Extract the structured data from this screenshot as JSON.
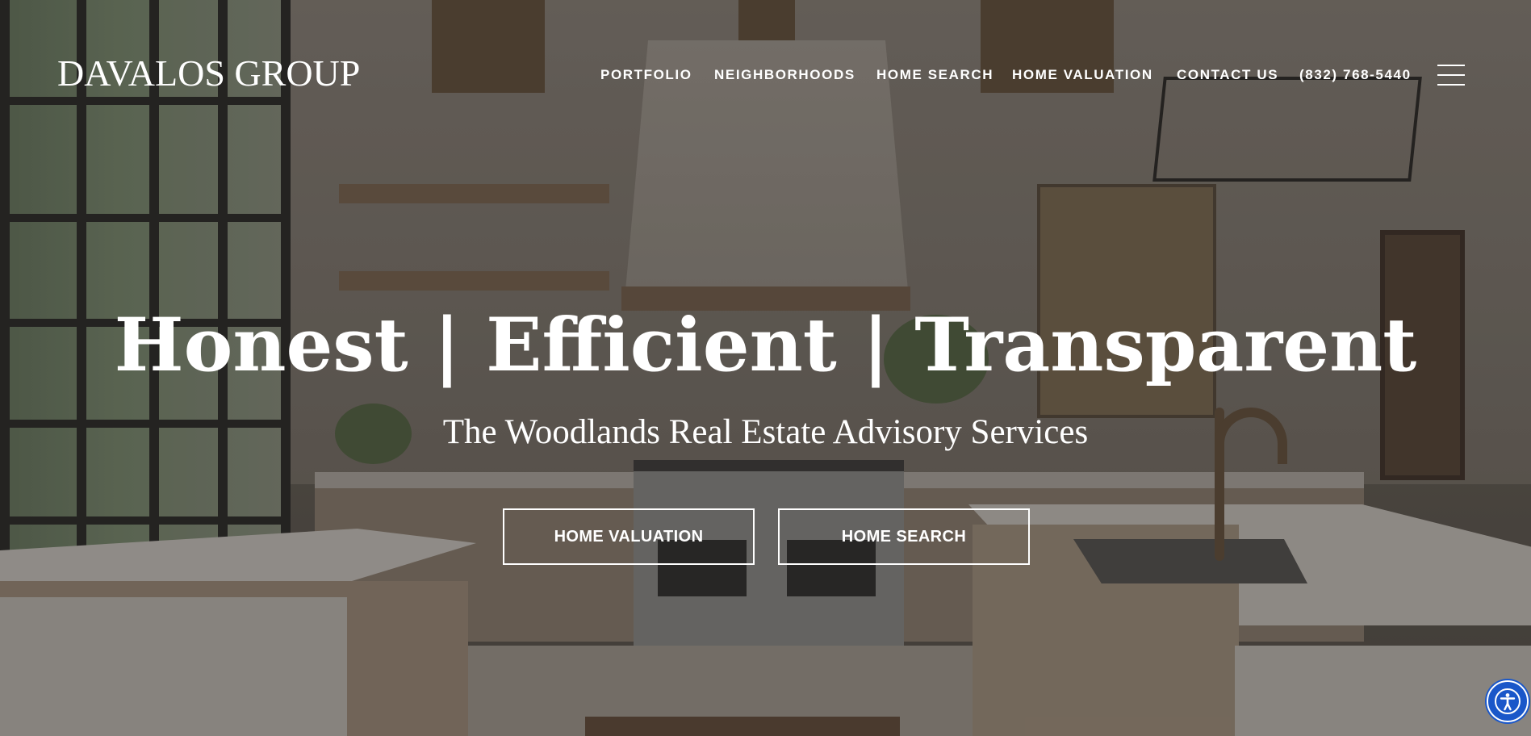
{
  "brand": {
    "logo_text": "DAVALOS GROUP"
  },
  "nav": {
    "items": [
      {
        "label": "PORTFOLIO"
      },
      {
        "label": "NEIGHBORHOODS"
      },
      {
        "label": "HOME SEARCH"
      },
      {
        "label": "HOME VALUATION"
      },
      {
        "label": "CONTACT US"
      },
      {
        "label": "(832) 768-5440"
      }
    ],
    "menu_icon": "hamburger-menu-icon"
  },
  "hero": {
    "headline": "Honest | Efficient | Transparent",
    "subheadline": "The Woodlands Real Estate Advisory Services",
    "buttons": [
      {
        "label": "HOME VALUATION"
      },
      {
        "label": "HOME SEARCH"
      }
    ]
  },
  "accessibility_widget": {
    "icon": "accessibility-icon",
    "color": "#1a57c9"
  }
}
